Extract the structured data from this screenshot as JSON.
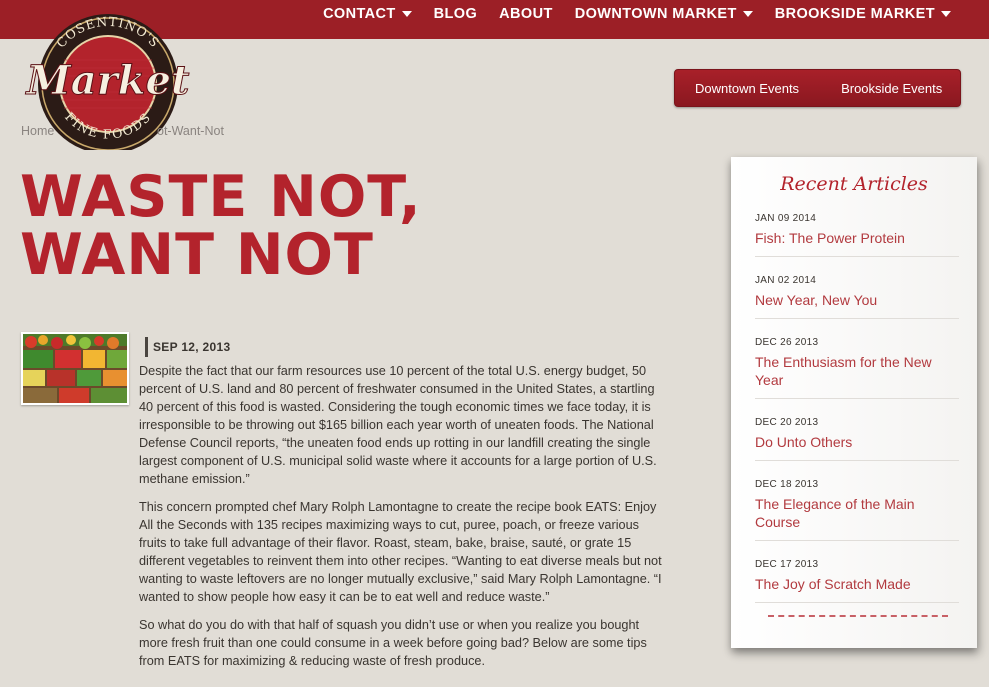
{
  "nav": [
    {
      "label": "CONTACT",
      "dropdown": true
    },
    {
      "label": "BLOG",
      "dropdown": false
    },
    {
      "label": "ABOUT",
      "dropdown": false
    },
    {
      "label": "DOWNTOWN MARKET",
      "dropdown": true
    },
    {
      "label": "BROOKSIDE MARKET",
      "dropdown": true
    }
  ],
  "logo": {
    "top_text": "COSENTINO'S",
    "main_text": "Market",
    "bottom_text": "FINE FOODS"
  },
  "events": {
    "downtown": "Downtown Events",
    "brookside": "Brookside Events"
  },
  "breadcrumb": {
    "home": "Home",
    "current": "ot-Want-Not"
  },
  "article": {
    "title_line1": "WASTE NOT,",
    "title_line2": "WANT NOT",
    "date": "SEP 12, 2013",
    "paragraphs": [
      "Despite the fact that our farm resources use 10 percent of the total U.S. energy budget, 50 percent of U.S. land and 80 percent of freshwater consumed in the United States, a startling 40 percent of this food is wasted. Considering the tough economic times we face today, it is irresponsible to be throwing out $165 billion each year worth of uneaten foods. The National Defense Council reports, “the uneaten food ends up rotting in our landfill creating the single largest component of U.S. municipal solid waste where it accounts for a large portion of U.S. methane emission.”",
      "This concern prompted chef Mary Rolph Lamontagne to create the recipe book EATS: Enjoy All the Seconds with 135 recipes maximizing ways to cut, puree, poach, or freeze various fruits to take full advantage of their flavor. Roast, steam, bake, braise, sauté, or grate 15 different vegetables to reinvent them into other recipes. “Wanting to eat diverse meals but not wanting to waste leftovers are no longer mutually exclusive,” said Mary Rolph Lamontagne. “I wanted to show people how easy it can be to eat well and reduce waste.”",
      "So what do you do with that half of squash you didn’t use or when you realize you bought more fresh fruit than one could consume in a week before going bad? Below are some tips from EATS for maximizing & reducing waste of fresh produce."
    ]
  },
  "sidebar": {
    "title": "Recent Articles",
    "items": [
      {
        "date": "JAN 09 2014",
        "title": "Fish: The Power Protein"
      },
      {
        "date": "JAN 02 2014",
        "title": "New Year, New You"
      },
      {
        "date": "DEC 26 2013",
        "title": "The Enthusiasm for the New Year"
      },
      {
        "date": "DEC 20 2013",
        "title": "Do Unto Others"
      },
      {
        "date": "DEC 18 2013",
        "title": "The Elegance of the Main Course"
      },
      {
        "date": "DEC 17 2013",
        "title": "The Joy of Scratch Made"
      }
    ]
  },
  "colors": {
    "brand_red": "#9c1f26",
    "title_red": "#b3232c",
    "background": "#e1ddd6"
  }
}
